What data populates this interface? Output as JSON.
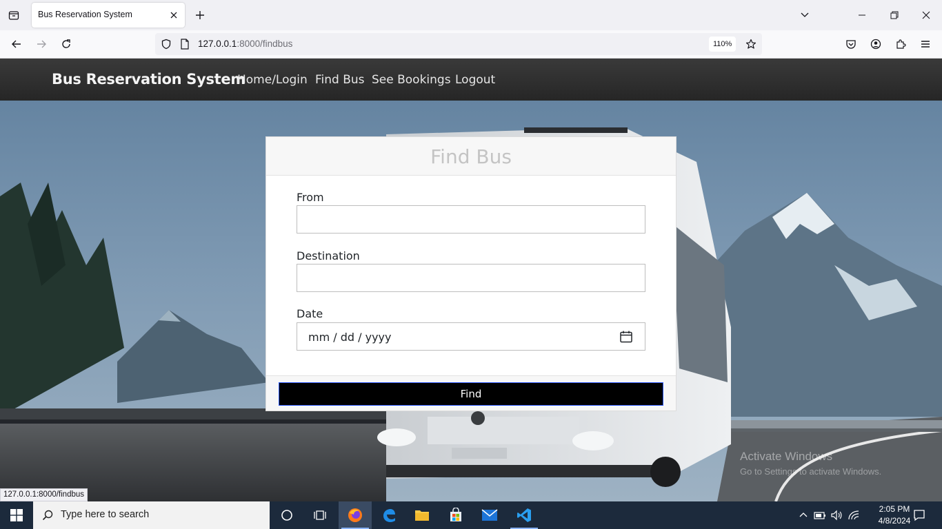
{
  "browser": {
    "tab_title": "Bus Reservation System",
    "url_host": "127.0.0.1",
    "url_path": ":8000/findbus",
    "zoom": "110%"
  },
  "site": {
    "brand": "Bus Reservation System",
    "nav": [
      {
        "label": "Home/Login"
      },
      {
        "label": "Find Bus"
      },
      {
        "label": "See Bookings"
      },
      {
        "label": "Logout"
      }
    ]
  },
  "form": {
    "title": "Find Bus",
    "from_label": "From",
    "from_value": "",
    "destination_label": "Destination",
    "destination_value": "",
    "date_label": "Date",
    "date_placeholder": "mm / dd / yyyy",
    "submit_label": "Find"
  },
  "overlay": {
    "watermark_title": "Activate Windows",
    "watermark_sub": "Go to Settings to activate Windows.",
    "status_url": "127.0.0.1:8000/findbus"
  },
  "taskbar": {
    "search_placeholder": "Type here to search",
    "time": "2:05 PM",
    "date": "4/8/2024"
  },
  "colors": {
    "site_nav": "#2e2e2e",
    "button_bg": "#000000",
    "taskbar": "#1c2a3c"
  }
}
